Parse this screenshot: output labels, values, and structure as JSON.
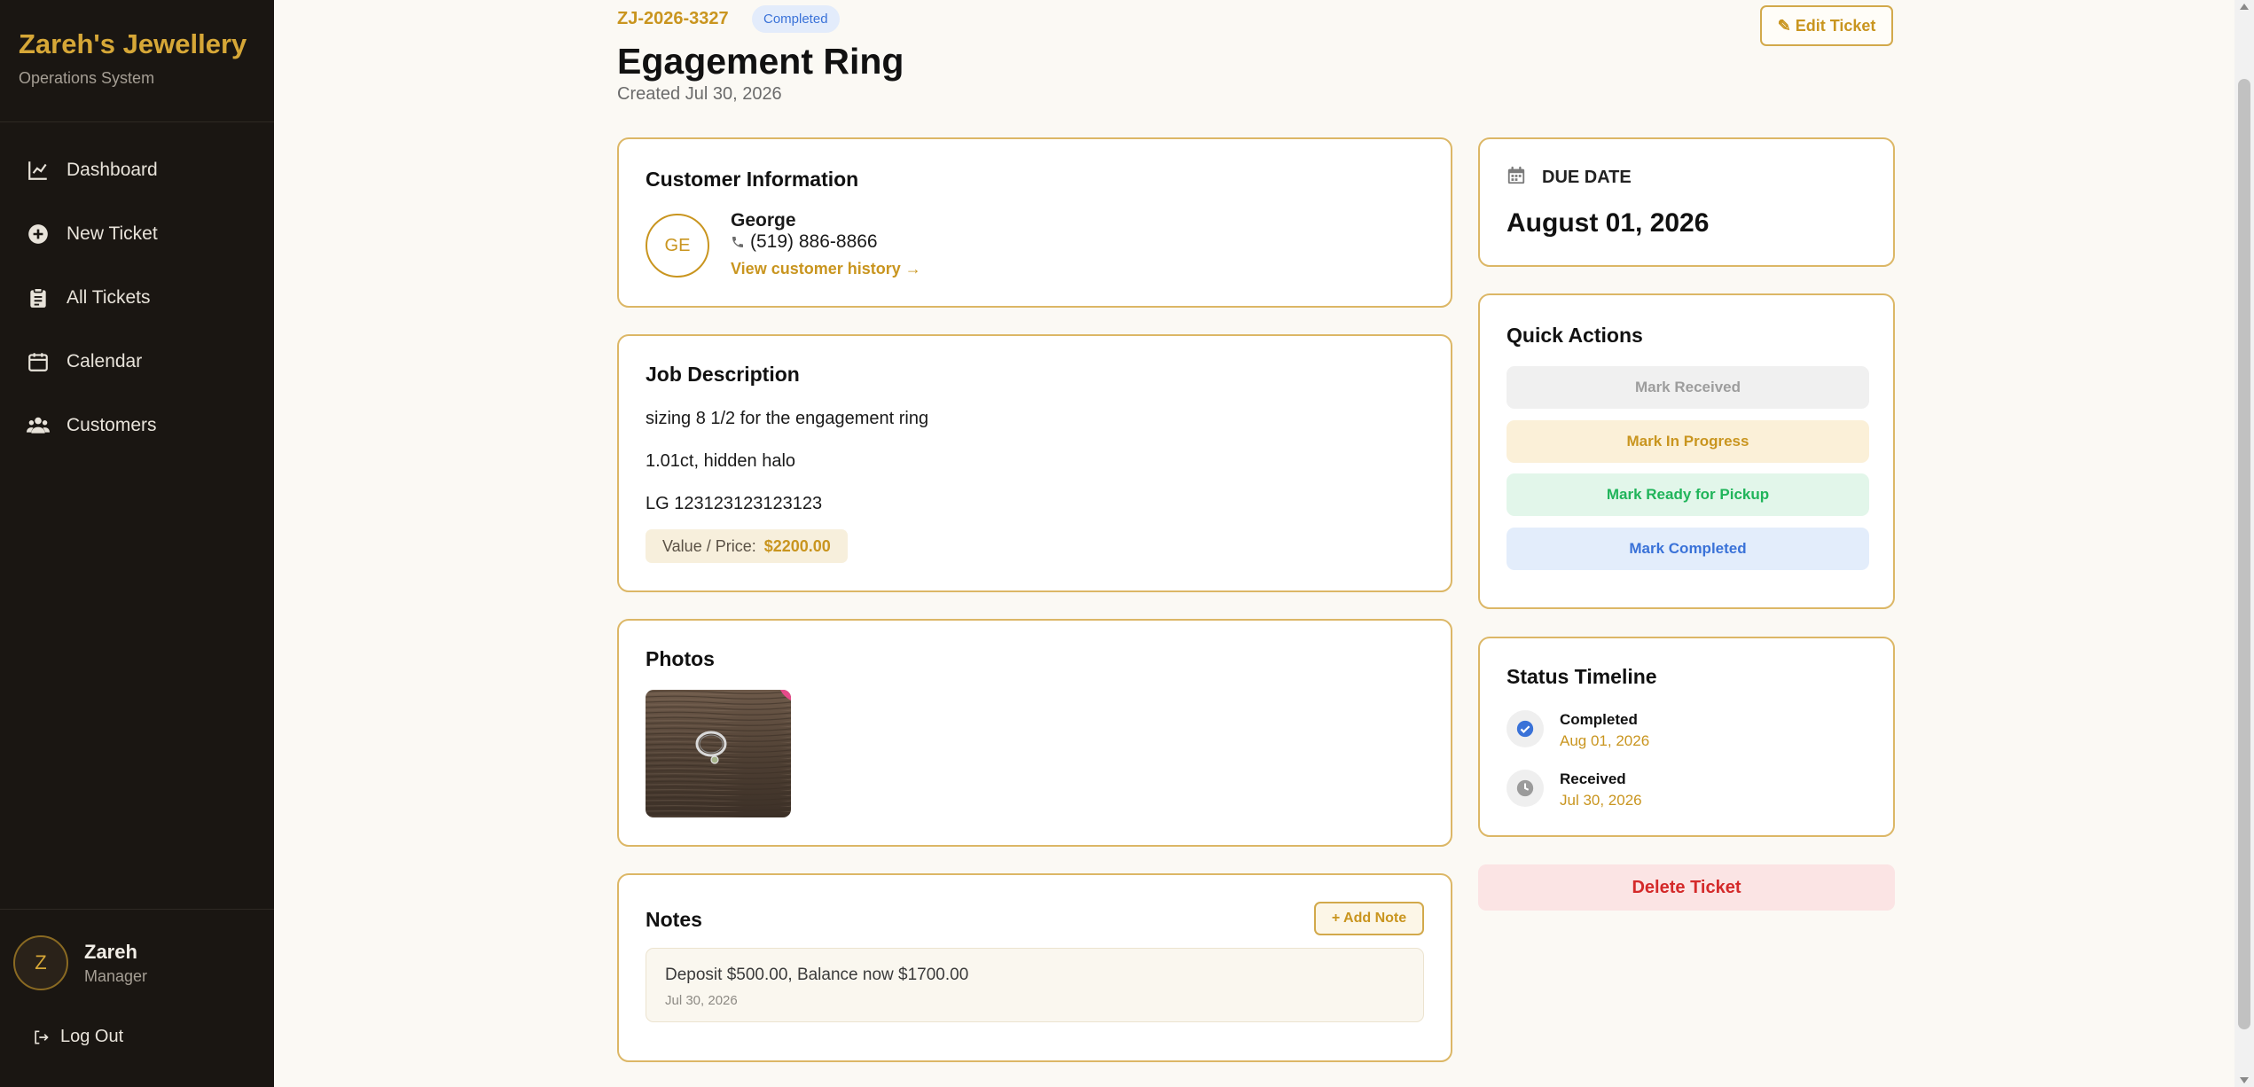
{
  "brand": {
    "title": "Zareh's Jewellery",
    "subtitle": "Operations System"
  },
  "nav": [
    {
      "label": "Dashboard",
      "icon": "chart-line-icon"
    },
    {
      "label": "New Ticket",
      "icon": "plus-circle-icon"
    },
    {
      "label": "All Tickets",
      "icon": "clipboard-icon"
    },
    {
      "label": "Calendar",
      "icon": "calendar-icon"
    },
    {
      "label": "Customers",
      "icon": "users-icon"
    }
  ],
  "user": {
    "initial": "Z",
    "name": "Zareh",
    "role": "Manager",
    "logout": "Log Out"
  },
  "ticket": {
    "id": "ZJ-2026-3327",
    "status": "Completed",
    "title": "Egagement Ring",
    "created": "Created Jul 30, 2026",
    "edit_label": "✎ Edit Ticket"
  },
  "customer": {
    "heading": "Customer Information",
    "initials": "GE",
    "name": "George",
    "phone": "(519) 886-8866",
    "history_link": "View customer history →"
  },
  "job": {
    "heading": "Job Description",
    "lines": [
      "sizing 8 1/2 for the engagement ring",
      "1.01ct, hidden halo",
      "LG 123123123123123"
    ],
    "price_label": "Value / Price:",
    "price_value": "$2200.00"
  },
  "photos": {
    "heading": "Photos"
  },
  "notes": {
    "heading": "Notes",
    "add_label": "+ Add Note",
    "items": [
      {
        "text": "Deposit $500.00, Balance now $1700.00",
        "date": "Jul 30, 2026"
      }
    ]
  },
  "due": {
    "label": "DUE DATE",
    "date": "August 01, 2026"
  },
  "quick_actions": {
    "heading": "Quick Actions",
    "buttons": [
      "Mark Received",
      "Mark In Progress",
      "Mark Ready for Pickup",
      "Mark Completed"
    ]
  },
  "timeline": {
    "heading": "Status Timeline",
    "items": [
      {
        "title": "Completed",
        "date": "Aug 01, 2026"
      },
      {
        "title": "Received",
        "date": "Jul 30, 2026"
      }
    ]
  },
  "delete_label": "Delete Ticket",
  "colors": {
    "accent": "#c9951f",
    "sidebar": "#1a1612",
    "completed_badge": "#3a72d8",
    "danger": "#d42a2a"
  }
}
